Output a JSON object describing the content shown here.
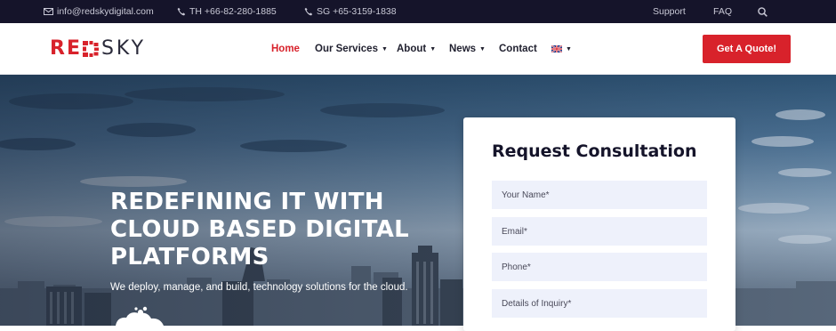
{
  "topbar": {
    "email": "info@redskydigital.com",
    "phone_th": "TH +66-82-280-1885",
    "phone_sg": "SG +65-3159-1838",
    "support": "Support",
    "faq": "FAQ"
  },
  "logo": {
    "part1": "RE",
    "part2": "SKY"
  },
  "nav": {
    "home": "Home",
    "services": "Our Services",
    "about": "About",
    "news": "News",
    "contact": "Contact"
  },
  "quote_button": "Get A Quote!",
  "hero": {
    "title_line1": "REDEFINING IT WITH",
    "title_line2": "CLOUD BASED DIGITAL",
    "title_line3": "PLATFORMS",
    "subtitle": "We deploy, manage, and build, technology solutions for the cloud."
  },
  "form": {
    "title": "Request Consultation",
    "name_placeholder": "Your Name*",
    "email_placeholder": "Email*",
    "phone_placeholder": "Phone*",
    "inquiry_placeholder": "Details of Inquiry*"
  },
  "colors": {
    "brand_red": "#d8222b",
    "topbar_bg": "#15142a",
    "field_bg": "#eef1fb"
  },
  "icons": [
    "envelope-icon",
    "phone-icon",
    "search-icon",
    "caret-down-icon",
    "uk-flag-icon",
    "cloud-icon"
  ]
}
